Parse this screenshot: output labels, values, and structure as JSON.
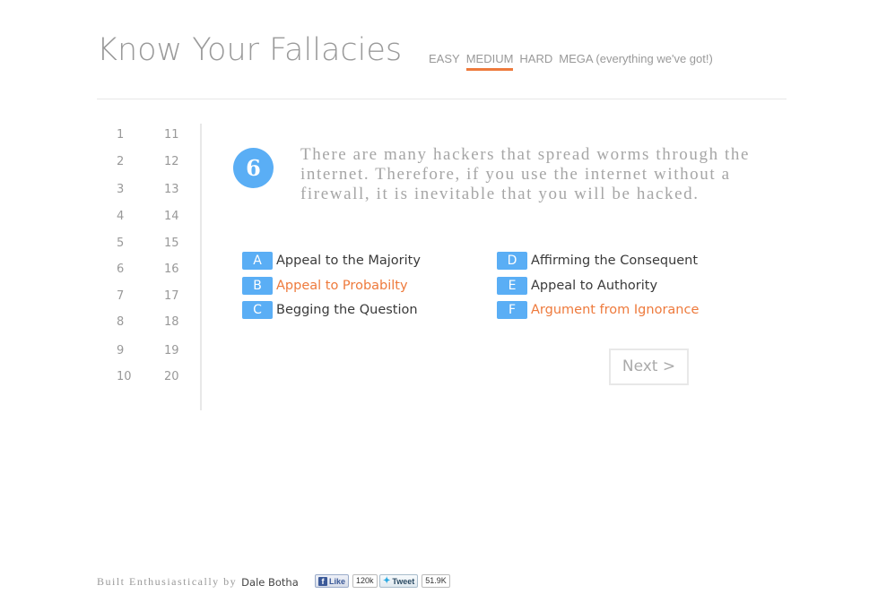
{
  "header": {
    "title": "Know Your Fallacies",
    "difficulty": [
      {
        "label": "EASY",
        "active": false
      },
      {
        "label": "MEDIUM",
        "active": true
      },
      {
        "label": "HARD",
        "active": false
      },
      {
        "label": "MEGA (everything we've got!)",
        "active": false
      }
    ]
  },
  "question_list": {
    "left_column": [
      "1",
      "2",
      "3",
      "4",
      "5",
      "6",
      "7",
      "8",
      "9",
      "10"
    ],
    "right_column": [
      "11",
      "12",
      "13",
      "14",
      "15",
      "16",
      "17",
      "18",
      "19",
      "20"
    ],
    "current": "6"
  },
  "question": {
    "number": "6",
    "text": "There are many hackers that spread worms through the internet. Therefore, if you use the internet without a firewall, it is inevitable that you will be hacked."
  },
  "answers": [
    {
      "letter": "A",
      "label": "Appeal to the Majority",
      "highlight": false
    },
    {
      "letter": "B",
      "label": "Appeal to Probabilty",
      "highlight": true
    },
    {
      "letter": "C",
      "label": "Begging the Question",
      "highlight": false
    },
    {
      "letter": "D",
      "label": "Affirming the Consequent",
      "highlight": false
    },
    {
      "letter": "E",
      "label": "Appeal to Authority",
      "highlight": false
    },
    {
      "letter": "F",
      "label": "Argument from Ignorance",
      "highlight": true
    }
  ],
  "next_button": {
    "label": "Next >"
  },
  "footer": {
    "built_text": "Built Enthusiastically by",
    "author": "Dale Botha"
  },
  "social": {
    "facebook": {
      "label": "Like",
      "count": "120k",
      "icon": "facebook-icon"
    },
    "twitter": {
      "label": "Tweet",
      "count": "51.9K",
      "icon": "twitter-bird-icon"
    }
  },
  "colors": {
    "accent_blue": "#5aaef5",
    "accent_orange": "#ee7a3c",
    "muted_text": "#999999"
  }
}
